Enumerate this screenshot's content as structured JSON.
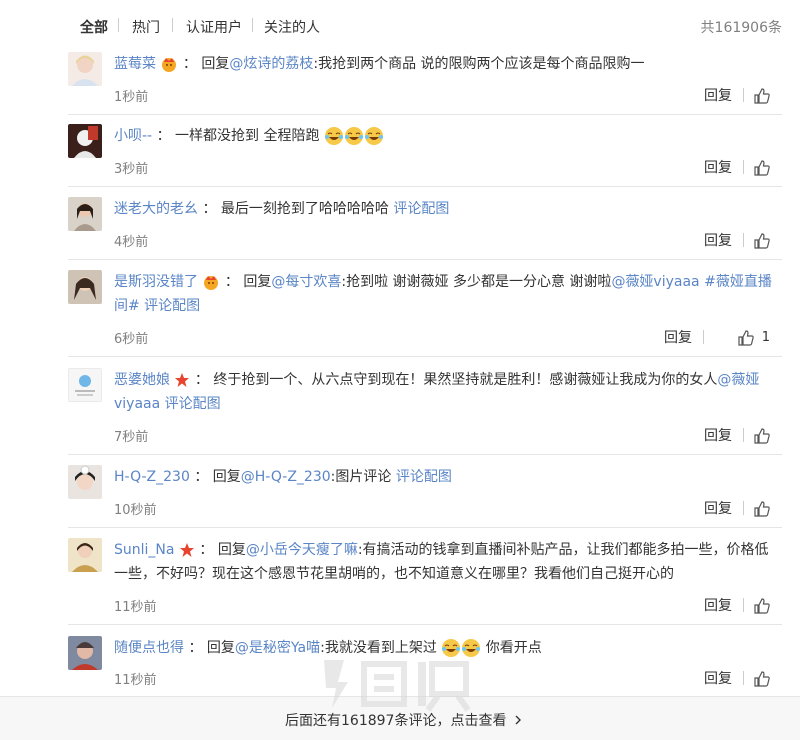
{
  "tabs": {
    "items": [
      {
        "label": "全部",
        "active": true
      },
      {
        "label": "热门",
        "active": false
      },
      {
        "label": "认证用户",
        "active": false
      },
      {
        "label": "关注的人",
        "active": false
      }
    ],
    "total": "共161906条"
  },
  "reply_label": "回复",
  "comments": [
    {
      "user": "蓝莓菜",
      "parts": [
        {
          "t": "回复",
          "c": "text"
        },
        {
          "t": "@炫诗的荔枝",
          "c": "link"
        },
        {
          "t": ":我抢到两个商品 说的限购两个应该是每个商品限购一",
          "c": "text"
        }
      ],
      "time": "1秒前",
      "likes": ""
    },
    {
      "user": "小呗--",
      "parts": [
        {
          "t": "一样都没抢到 全程陪跑",
          "c": "text"
        }
      ],
      "time": "3秒前",
      "likes": ""
    },
    {
      "user": "迷老大的老幺",
      "parts": [
        {
          "t": "最后一刻抢到了哈哈哈哈哈 ",
          "c": "text"
        },
        {
          "t": "评论配图",
          "c": "link"
        }
      ],
      "time": "4秒前",
      "likes": ""
    },
    {
      "user": "是斯羽没错了",
      "parts": [
        {
          "t": "回复",
          "c": "text"
        },
        {
          "t": "@每寸欢喜",
          "c": "link"
        },
        {
          "t": ":抢到啦 谢谢薇娅 多少都是一分心意 谢谢啦",
          "c": "text"
        },
        {
          "t": "@薇娅viyaaa",
          "c": "link"
        },
        {
          "t": " ",
          "c": "text"
        },
        {
          "t": "#薇娅直播间#",
          "c": "link"
        },
        {
          "t": " 评论配图",
          "c": "link"
        }
      ],
      "time": "6秒前",
      "likes": "1"
    },
    {
      "user": "恶婆她娘",
      "parts": [
        {
          "t": "终于抢到一个、从六点守到现在！果然坚持就是胜利！感谢薇娅让我成为你的女人",
          "c": "text"
        },
        {
          "t": "@薇娅viyaaa",
          "c": "link"
        },
        {
          "t": " 评论配图",
          "c": "link"
        }
      ],
      "time": "7秒前",
      "likes": ""
    },
    {
      "user": "H-Q-Z_230",
      "parts": [
        {
          "t": "回复",
          "c": "text"
        },
        {
          "t": "@H-Q-Z_230",
          "c": "link"
        },
        {
          "t": ":图片评论 ",
          "c": "text"
        },
        {
          "t": "评论配图",
          "c": "link"
        }
      ],
      "time": "10秒前",
      "likes": ""
    },
    {
      "user": "Sunli_Na",
      "parts": [
        {
          "t": "回复",
          "c": "text"
        },
        {
          "t": "@小岳今天瘦了嘛",
          "c": "link"
        },
        {
          "t": ":有搞活动的钱拿到直播间补贴产品，让我们都能多拍一些，价格低一些，不好吗？现在这个感恩节花里胡哨的，也不知道意义在哪里？我看他们自己挺开心的",
          "c": "text"
        }
      ],
      "time": "11秒前",
      "likes": ""
    },
    {
      "user": "随便点也得",
      "parts": [
        {
          "t": "回复",
          "c": "text"
        },
        {
          "t": "@是秘密Ya喵",
          "c": "link"
        },
        {
          "t": ":我就没看到上架过",
          "c": "text"
        }
      ],
      "tail": "你看开点",
      "time": "11秒前",
      "likes": ""
    }
  ],
  "footer": {
    "more": "后面还有161897条评论，点击查看"
  },
  "colors": {
    "link": "#5a85c6",
    "muted": "#808080",
    "text": "#333333"
  }
}
